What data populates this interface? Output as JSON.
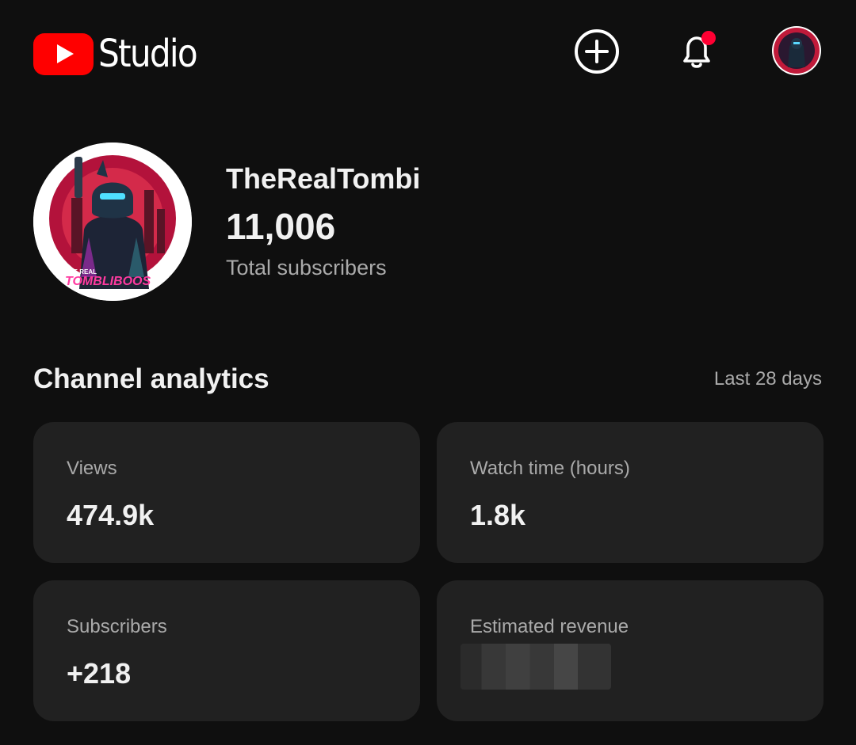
{
  "header": {
    "app_name": "Studio",
    "icons": {
      "logo": "youtube-play-icon",
      "create": "add-circle-icon",
      "notifications": "bell-icon",
      "account": "avatar"
    },
    "brand_color": "#ff0000",
    "notification_dot_color": "#ff0033"
  },
  "channel": {
    "name": "TheRealTombi",
    "subscriber_count": "11,006",
    "subscriber_label": "Total subscribers",
    "avatar_text": {
      "line1": "THE REAL",
      "line2": "TOMBLIBOOS"
    }
  },
  "analytics": {
    "title": "Channel analytics",
    "period": "Last 28 days",
    "cards": [
      {
        "label": "Views",
        "value": "474.9k"
      },
      {
        "label": "Watch time (hours)",
        "value": "1.8k"
      },
      {
        "label": "Subscribers",
        "value": "+218"
      },
      {
        "label": "Estimated revenue",
        "value": ""
      }
    ]
  }
}
